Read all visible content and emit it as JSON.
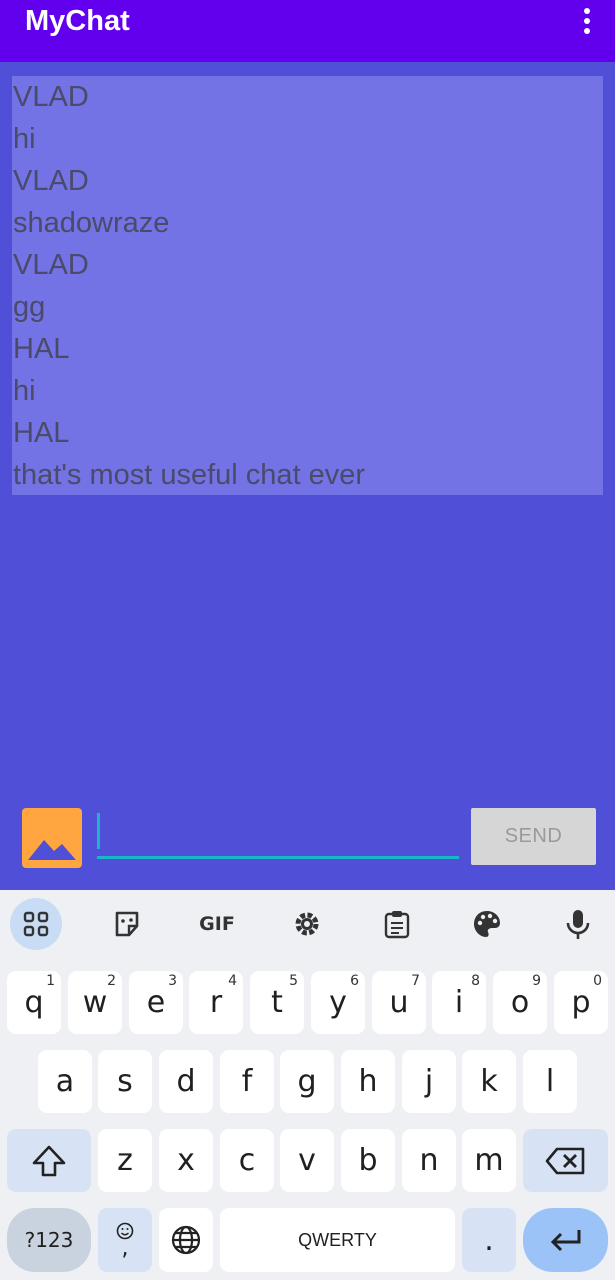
{
  "app": {
    "title": "MyChat"
  },
  "chat": {
    "messages": [
      "VLAD",
      "hi",
      "VLAD",
      "shadowraze",
      "VLAD",
      "gg",
      "HAL",
      "hi",
      "HAL",
      "that's most useful chat ever"
    ]
  },
  "composer": {
    "input_value": "",
    "send_label": "SEND",
    "image_icon": "image-icon"
  },
  "keyboard": {
    "toolbar": [
      "apps-icon",
      "sticker-icon",
      "GIF",
      "gear-icon",
      "clipboard-icon",
      "palette-icon",
      "mic-icon"
    ],
    "gif_label": "GIF",
    "row1": [
      {
        "k": "q",
        "n": "1"
      },
      {
        "k": "w",
        "n": "2"
      },
      {
        "k": "e",
        "n": "3"
      },
      {
        "k": "r",
        "n": "4"
      },
      {
        "k": "t",
        "n": "5"
      },
      {
        "k": "y",
        "n": "6"
      },
      {
        "k": "u",
        "n": "7"
      },
      {
        "k": "i",
        "n": "8"
      },
      {
        "k": "o",
        "n": "9"
      },
      {
        "k": "p",
        "n": "0"
      }
    ],
    "row2": [
      "a",
      "s",
      "d",
      "f",
      "g",
      "h",
      "j",
      "k",
      "l"
    ],
    "row3": [
      "z",
      "x",
      "c",
      "v",
      "b",
      "n",
      "m"
    ],
    "mode_label": "?123",
    "emoji_comma": ",",
    "space_label": "QWERTY",
    "period_label": "."
  },
  "colors": {
    "appbar": "#6200ee",
    "background": "#4f4fd8",
    "chat_panel": "#7373e5",
    "accent": "#19b5c8",
    "image_button": "#ffa640"
  }
}
